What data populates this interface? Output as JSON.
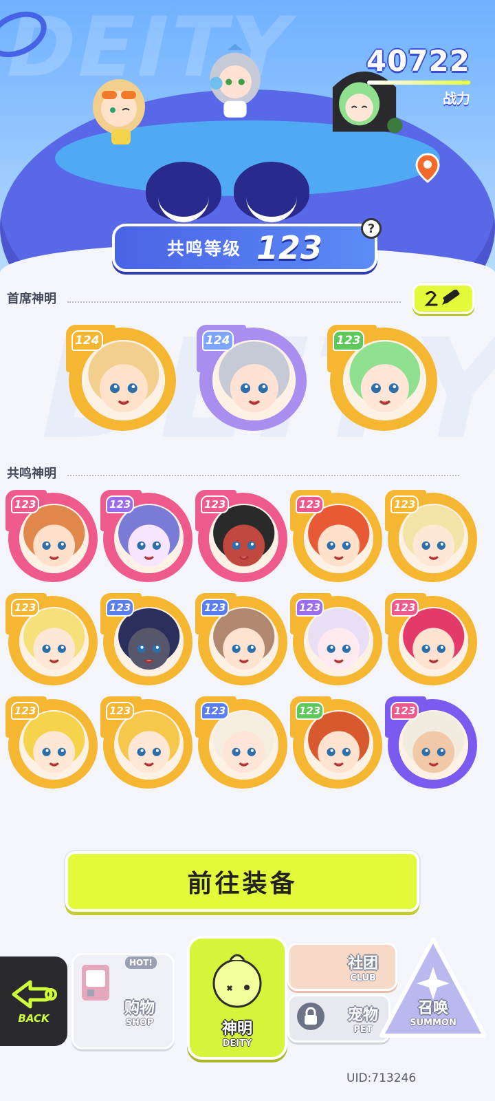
{
  "header": {
    "bg_word": "DEITY",
    "power_value": "40722",
    "power_label": "战力",
    "resonance_label": "共鸣等级",
    "resonance_value": "123",
    "help_symbol": "?"
  },
  "sections": {
    "chief_title": "首席神明",
    "resonance_title": "共鸣神明"
  },
  "chief_deities": [
    {
      "level": "124",
      "frame": "#f5b631",
      "tag": "#f5b631",
      "hair": "#f3cf8e",
      "skin": "#ffe2c9"
    },
    {
      "level": "124",
      "frame": "#a98ef0",
      "tag": "#7ea6ff",
      "hair": "#c6c9d6",
      "skin": "#ffe2d4"
    },
    {
      "level": "123",
      "frame": "#f5b631",
      "tag": "#5ec95a",
      "hair": "#8fe08f",
      "skin": "#ffe6d6"
    }
  ],
  "resonance_deities": [
    {
      "level": "123",
      "frame": "#ef5a8c",
      "tag": "#ef5a8c",
      "hair": "#e0884c",
      "skin": "#ffe0cb"
    },
    {
      "level": "123",
      "frame": "#ef5a8c",
      "tag": "#9a6cf0",
      "hair": "#7a7bd6",
      "skin": "#f7e4ff"
    },
    {
      "level": "123",
      "frame": "#ef5a8c",
      "tag": "#ef5a8c",
      "hair": "#2a2a2a",
      "skin": "#c0483f"
    },
    {
      "level": "123",
      "frame": "#f5b631",
      "tag": "#ef5a8c",
      "hair": "#e85a35",
      "skin": "#ffe0cb"
    },
    {
      "level": "123",
      "frame": "#f5b631",
      "tag": "#f5b631",
      "hair": "#f3e3a7",
      "skin": "#ffe7d6"
    },
    {
      "level": "123",
      "frame": "#f5b631",
      "tag": "#f5b631",
      "hair": "#f5e07a",
      "skin": "#ffe7d6"
    },
    {
      "level": "123",
      "frame": "#f5b631",
      "tag": "#5a7ef0",
      "hair": "#2a2f5c",
      "skin": "#57566a"
    },
    {
      "level": "123",
      "frame": "#f5b631",
      "tag": "#5a7ef0",
      "hair": "#b08870",
      "skin": "#ffe2cf"
    },
    {
      "level": "123",
      "frame": "#f5b631",
      "tag": "#9a6cf0",
      "hair": "#e8dff5",
      "skin": "#ffeaf0"
    },
    {
      "level": "123",
      "frame": "#f5b631",
      "tag": "#ef5a8c",
      "hair": "#e43a6a",
      "skin": "#ffe2cf"
    },
    {
      "level": "123",
      "frame": "#f5b631",
      "tag": "#f5b631",
      "hair": "#f5d34a",
      "skin": "#ffe7d6"
    },
    {
      "level": "123",
      "frame": "#f5b631",
      "tag": "#f5b631",
      "hair": "#f5c74a",
      "skin": "#ffe7d6"
    },
    {
      "level": "123",
      "frame": "#f5b631",
      "tag": "#5a7ef0",
      "hair": "#f4ede0",
      "skin": "#ffe5d8"
    },
    {
      "level": "123",
      "frame": "#f5b631",
      "tag": "#5ec95a",
      "hair": "#d9592e",
      "skin": "#ffe2cf"
    },
    {
      "level": "123",
      "frame": "#7b5af0",
      "tag": "#ef5a8c",
      "hair": "#f2ece0",
      "skin": "#f2c9a8"
    }
  ],
  "actions": {
    "equip_label": "前往装备"
  },
  "nav": {
    "back_label": "BACK",
    "shop_main": "购物",
    "shop_sub": "SHOP",
    "shop_tag": "HOT!",
    "deity_main": "神明",
    "deity_sub": "DEITY",
    "club_main": "社团",
    "club_sub": "CLUB",
    "pet_main": "宠物",
    "pet_sub": "PET",
    "summon_main": "召唤",
    "summon_sub": "SUMMON"
  },
  "footer": {
    "uid": "UID:713246"
  },
  "colors": {
    "accent_lime": "#e3fa3a",
    "header_blue": "#6fb1ff",
    "planet_purple": "#5868e6"
  }
}
